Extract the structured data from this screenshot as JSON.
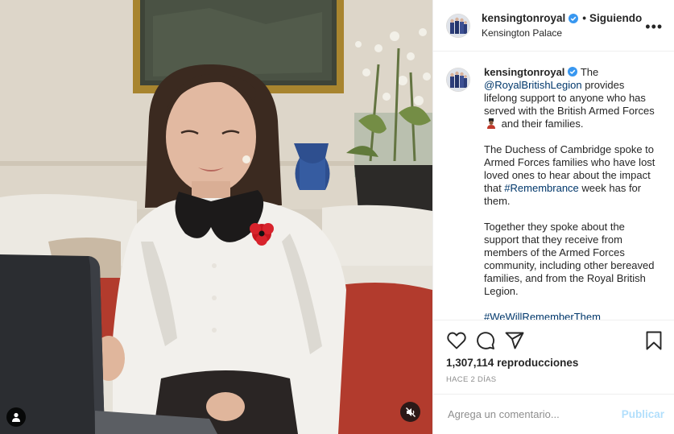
{
  "media": {
    "type": "video",
    "user_icon": "user-icon",
    "mute_icon": "muted-speaker-icon"
  },
  "header": {
    "username": "kensingtonroyal",
    "separator": "•",
    "follow_status": "Siguiendo",
    "location": "Kensington Palace",
    "more_label": "•••"
  },
  "caption": {
    "username": "kensingtonroyal",
    "p1_mention": "@RoyalBritishLegion",
    "p1_text": " provides lifelong support to anyone who has served with the British Armed Forces",
    "p1_end": " and their families.",
    "p2_text": "The Duchess of Cambridge spoke to Armed Forces families who have lost loved ones to hear about the impact that ",
    "p2_hashtag": "#Remembrance",
    "p2_end": " week has for them.",
    "p3_text": "Together they spoke about the support that they receive from members of the Armed Forces community, including other bereaved families, and from the Royal British Legion.",
    "p4_hashtag": "#WeWillRememberThem",
    "p1_joiner": "The"
  },
  "actions": {
    "icons": [
      "heart-icon",
      "comment-icon",
      "share-icon",
      "bookmark-icon"
    ],
    "views": "1,307,114 reproducciones",
    "timestamp": "HACE 2 DÍAS"
  },
  "comment": {
    "placeholder": "Agrega un comentario...",
    "publish_label": "Publicar"
  },
  "colors": {
    "link": "#00376b",
    "publish_disabled": "#b2dffc",
    "verified": "#3897f0",
    "muted_text": "#8e8e8e"
  }
}
